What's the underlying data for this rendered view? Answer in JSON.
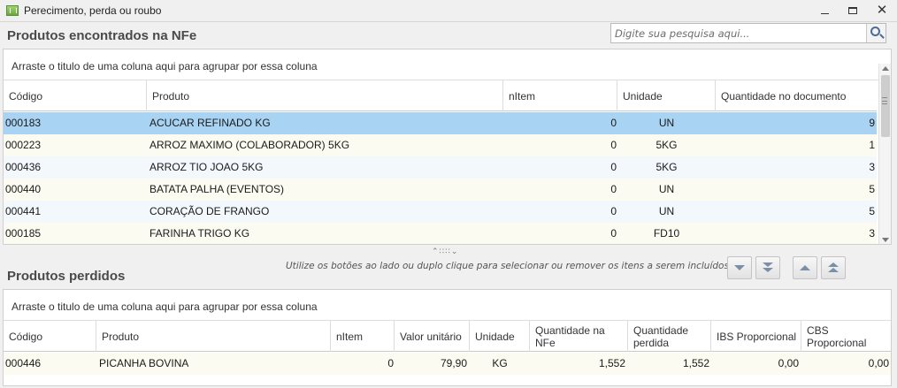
{
  "window": {
    "title": "Perecimento, perda ou roubo"
  },
  "found_section": {
    "title": "Produtos encontrados na NFe",
    "search_placeholder": "Digite sua pesquisa aqui...",
    "group_hint": "Arraste o titulo de uma coluna aqui para agrupar por essa coluna",
    "columns": [
      "Código",
      "Produto",
      "nItem",
      "Unidade",
      "Quantidade no documento"
    ],
    "rows": [
      {
        "codigo": "000183",
        "produto": "ACUCAR REFINADO KG",
        "nitem": "0",
        "unidade": "UN",
        "quantidade": "9",
        "selected": true
      },
      {
        "codigo": "000223",
        "produto": "ARROZ MAXIMO (COLABORADOR) 5KG",
        "nitem": "0",
        "unidade": "5KG",
        "quantidade": "1"
      },
      {
        "codigo": "000436",
        "produto": "ARROZ TIO JOAO 5KG",
        "nitem": "0",
        "unidade": "5KG",
        "quantidade": "3"
      },
      {
        "codigo": "000440",
        "produto": "BATATA PALHA (EVENTOS)",
        "nitem": "0",
        "unidade": "UN",
        "quantidade": "5"
      },
      {
        "codigo": "000441",
        "produto": "CORAÇÃO DE FRANGO",
        "nitem": "0",
        "unidade": "UN",
        "quantidade": "5"
      },
      {
        "codigo": "000185",
        "produto": "FARINHA TRIGO KG",
        "nitem": "0",
        "unidade": "FD10",
        "quantidade": "3"
      }
    ]
  },
  "lost_section": {
    "title": "Produtos perdidos",
    "instruction": "Utilize os botões ao lado ou duplo clique para selecionar ou remover os itens a serem incluídos",
    "group_hint": "Arraste o titulo de uma coluna aqui para agrupar por essa coluna",
    "columns": [
      "Código",
      "Produto",
      "nItem",
      "Valor unitário",
      "Unidade",
      "Quantidade na NFe",
      "Quantidade perdida",
      "IBS Proporcional",
      "CBS Proporcional"
    ],
    "rows": [
      {
        "codigo": "000446",
        "produto": "PICANHA BOVINA",
        "nitem": "0",
        "valor_unitario": "79,90",
        "unidade": "KG",
        "qtd_nfe": "1,552",
        "qtd_perdida": "1,552",
        "ibs": "0,00",
        "cbs": "0,00"
      }
    ]
  },
  "actions": {
    "icons": [
      "move-down-icon",
      "move-all-down-icon",
      "move-up-icon",
      "move-all-up-icon"
    ]
  },
  "colors": {
    "selected_row": "#a9d3f2",
    "alt_row": "#fbfbf1",
    "section_title": "#4a4a4a"
  }
}
